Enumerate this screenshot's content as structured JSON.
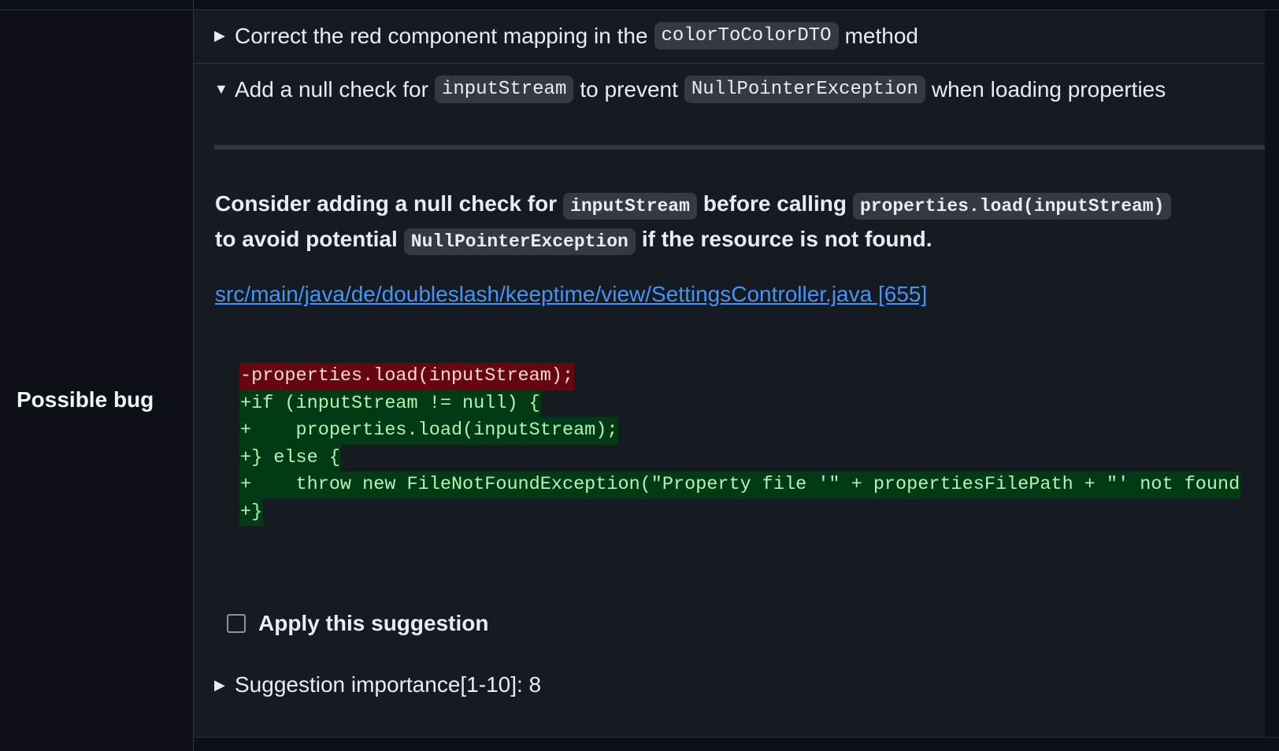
{
  "category": {
    "label": "Possible bug"
  },
  "suggestions": [
    {
      "expanded": false,
      "parts": [
        "Correct the red component mapping in the",
        "colorToColorDTO",
        "method"
      ]
    },
    {
      "expanded": true,
      "parts": [
        "Add a null check for",
        "inputStream",
        "to prevent",
        "NullPointerException",
        "when loading properties"
      ]
    }
  ],
  "detail": {
    "line1": [
      "Consider adding a null check for",
      "inputStream",
      "before calling",
      "properties.load(inputStream)"
    ],
    "line2": [
      "to avoid potential",
      "NullPointerException",
      "if the resource is not found."
    ],
    "file_link": "src/main/java/de/doubleslash/keeptime/view/SettingsController.java [655]",
    "diff": [
      {
        "type": "del",
        "text": "-properties.load(inputStream);"
      },
      {
        "type": "add",
        "text": "+if (inputStream != null) {"
      },
      {
        "type": "add",
        "text": "+    properties.load(inputStream);"
      },
      {
        "type": "add",
        "text": "+} else {"
      },
      {
        "type": "add",
        "text": "+    throw new FileNotFoundException(\"Property file '\" + propertiesFilePath + \"' not found"
      },
      {
        "type": "add",
        "text": "+}"
      }
    ],
    "apply_label": "Apply this suggestion",
    "importance_label": "Suggestion importance[1-10]: 8"
  },
  "icons": {
    "collapsed": "triangle-right-icon",
    "expanded": "triangle-down-icon"
  }
}
